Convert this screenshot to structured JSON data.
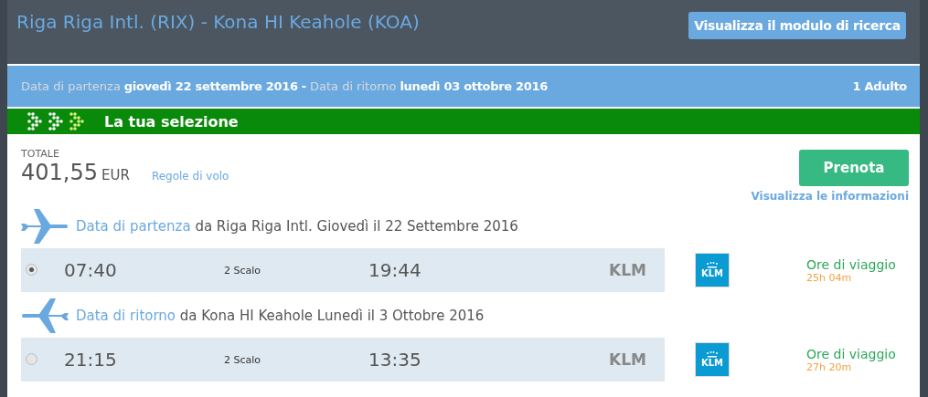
{
  "header": {
    "title": "Riga Riga Intl. (RIX) - Kona HI Keahole (KOA)",
    "search_button": "Visualizza il modulo di ricerca"
  },
  "dates_bar": {
    "departure_label": "Data di partenza",
    "departure_date": "giovedì 22 settembre 2016",
    "separator": "-",
    "return_label": "Data di ritorno",
    "return_date": "lunedì 03 ottobre 2016",
    "passengers": "1 Adulto"
  },
  "selection_bar": {
    "title": "La tua selezione"
  },
  "summary": {
    "total_label": "TOTALE",
    "amount": "401,55",
    "currency": "EUR",
    "rules_link": "Regole di volo",
    "book_button": "Prenota",
    "info_link": "Visualizza le informazioni"
  },
  "flights": [
    {
      "kind": "outbound",
      "label": "Data di partenza",
      "description": "da Riga Riga Intl. Giovedì il 22 Settembre 2016",
      "selected": true,
      "depart_time": "07:40",
      "stops": "2 Scalo",
      "arrive_time": "19:44",
      "airline": "KLM",
      "logo_text": "KLM",
      "duration_label": "Ore di viaggio",
      "duration": "25h 04m"
    },
    {
      "kind": "return",
      "label": "Data di ritorno",
      "description": "da Kona HI Keahole Lunedì il 3 Ottobre 2016",
      "selected": false,
      "depart_time": "21:15",
      "stops": "2 Scalo",
      "arrive_time": "13:35",
      "airline": "KLM",
      "logo_text": "KLM",
      "duration_label": "Ore di viaggio",
      "duration": "27h 20m"
    }
  ]
}
